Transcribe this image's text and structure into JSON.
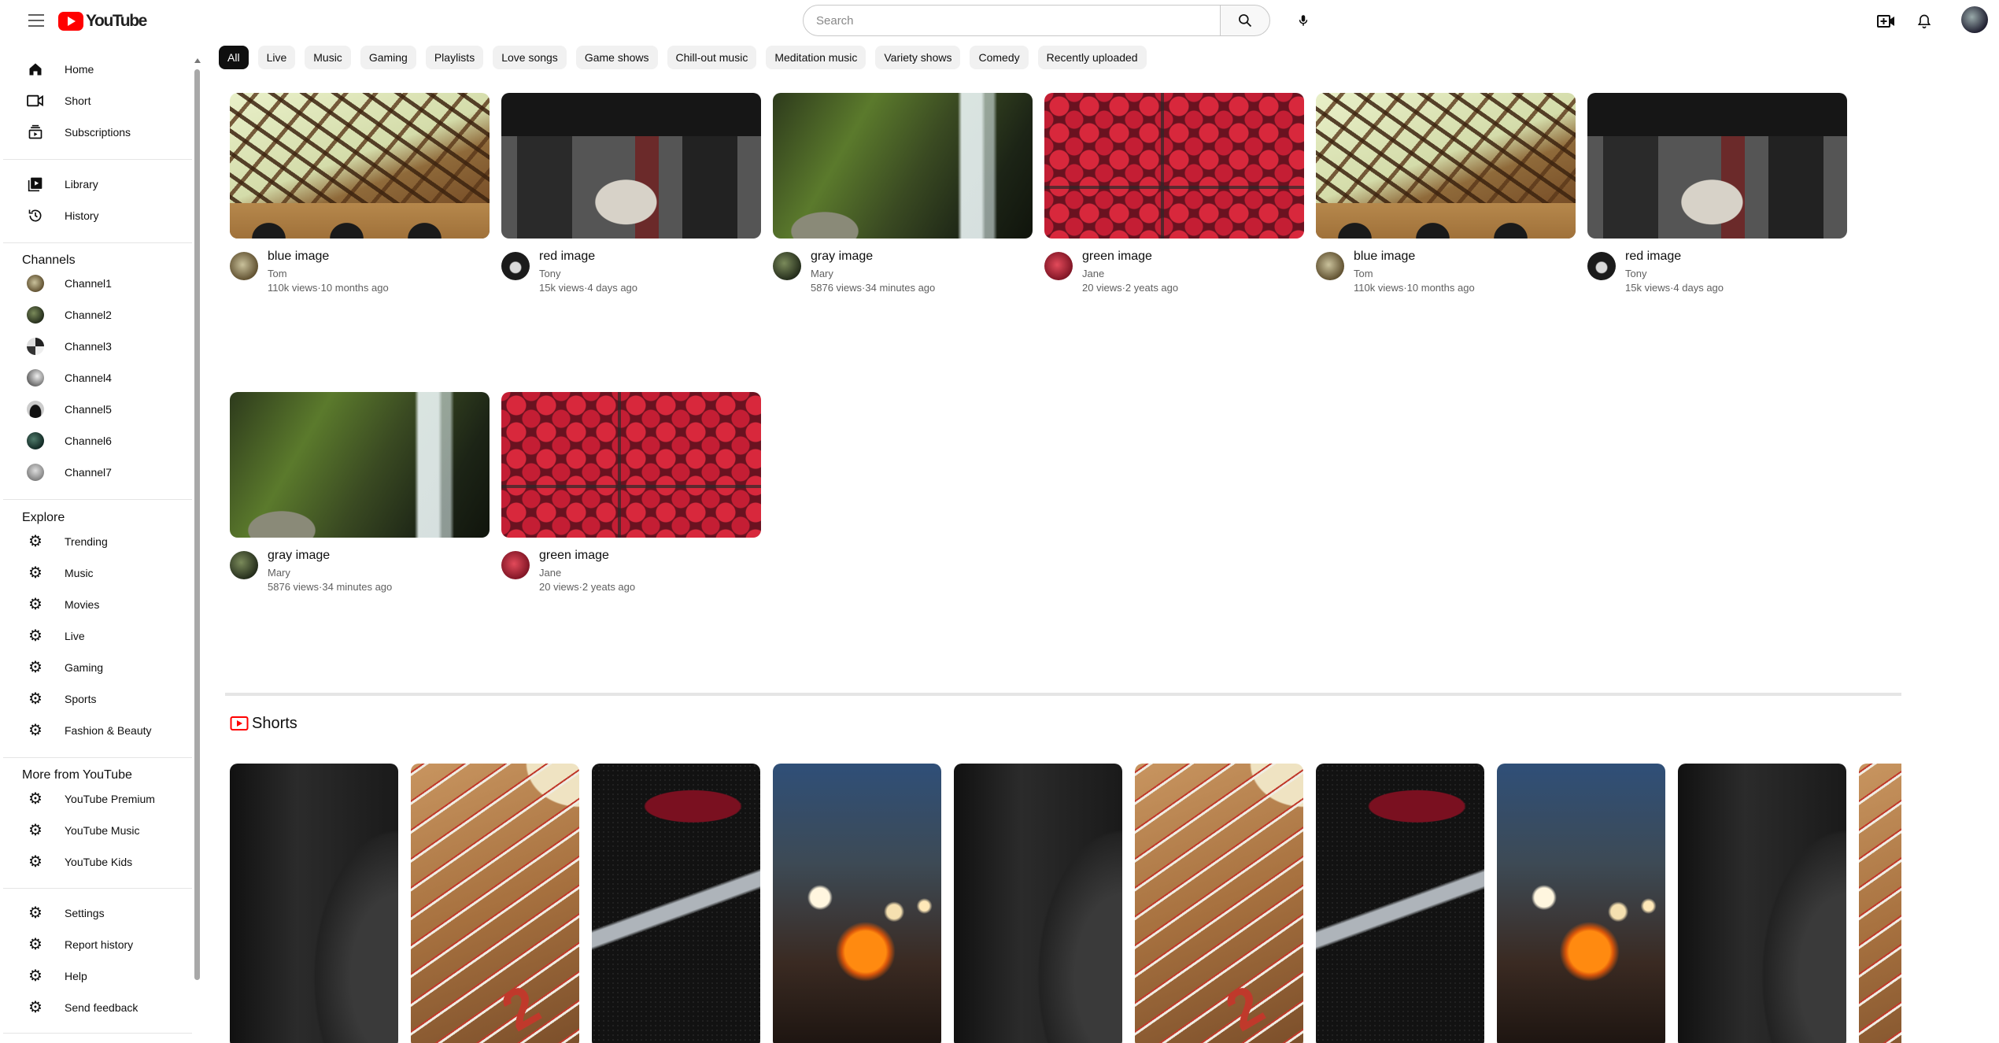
{
  "header": {
    "logo_text": "YouTube",
    "search_placeholder": "Search"
  },
  "sidebar": {
    "main": [
      {
        "label": "Home",
        "icon": "home-icon"
      },
      {
        "label": "Short",
        "icon": "shorts-icon"
      },
      {
        "label": "Subscriptions",
        "icon": "subscriptions-icon"
      }
    ],
    "library": [
      {
        "label": "Library",
        "icon": "library-icon"
      },
      {
        "label": "History",
        "icon": "history-icon"
      }
    ],
    "channels_heading": "Channels",
    "channels": [
      {
        "label": "Channel1"
      },
      {
        "label": "Channel2"
      },
      {
        "label": "Channel3"
      },
      {
        "label": "Channel4"
      },
      {
        "label": "Channel5"
      },
      {
        "label": "Channel6"
      },
      {
        "label": "Channel7"
      }
    ],
    "explore_heading": "Explore",
    "explore": [
      {
        "label": "Trending"
      },
      {
        "label": "Music"
      },
      {
        "label": "Movies"
      },
      {
        "label": "Live"
      },
      {
        "label": "Gaming"
      },
      {
        "label": "Sports"
      },
      {
        "label": "Fashion & Beauty"
      }
    ],
    "more_heading": "More from YouTube",
    "more": [
      {
        "label": "YouTube Premium"
      },
      {
        "label": "YouTube Music"
      },
      {
        "label": "YouTube Kids"
      }
    ],
    "footer": [
      {
        "label": "Settings"
      },
      {
        "label": "Report history"
      },
      {
        "label": "Help"
      },
      {
        "label": "Send feedback"
      }
    ]
  },
  "chips": [
    "All",
    "Live",
    "Music",
    "Gaming",
    "Playlists",
    "Love songs",
    "Game shows",
    "Chill-out music",
    "Meditation music",
    "Variety shows",
    "Comedy",
    "Recently uploaded"
  ],
  "videos": [
    {
      "title": "blue image",
      "channel": "Tom",
      "meta": "110k views·10 months ago"
    },
    {
      "title": "red image",
      "channel": "Tony",
      "meta": "15k views·4 days ago"
    },
    {
      "title": "gray image",
      "channel": "Mary",
      "meta": "5876 views·34 minutes ago"
    },
    {
      "title": "green image",
      "channel": "Jane",
      "meta": "20 views·2 yeats ago"
    },
    {
      "title": "blue image",
      "channel": "Tom",
      "meta": "110k views·10 months ago"
    },
    {
      "title": "red image",
      "channel": "Tony",
      "meta": "15k views·4 days ago"
    },
    {
      "title": "gray image",
      "channel": "Mary",
      "meta": "5876 views·34 minutes ago"
    },
    {
      "title": "green image",
      "channel": "Jane",
      "meta": "20 views·2 yeats ago"
    }
  ],
  "shorts": {
    "title": "Shorts",
    "icon_color": "#ff0000"
  },
  "colors": {
    "accent": "#ff0000",
    "chip_active_bg": "#0f0f0f",
    "chip_bg": "#f1f1f1"
  }
}
